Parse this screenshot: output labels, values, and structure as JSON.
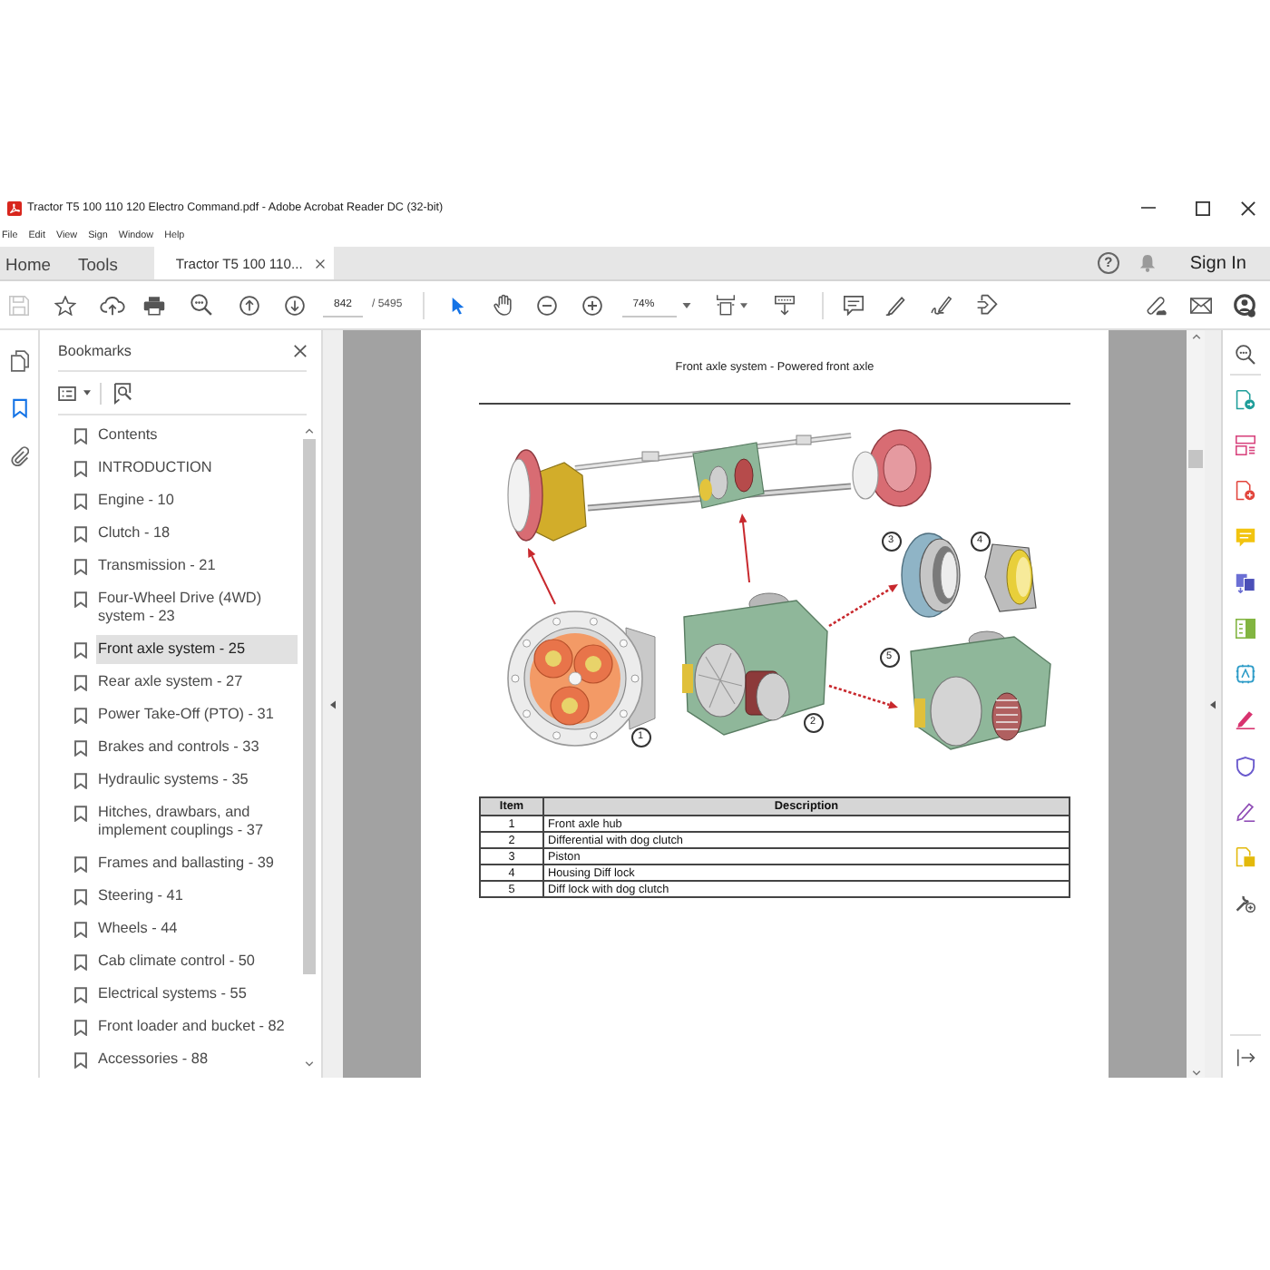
{
  "window": {
    "title": "Tractor T5 100 110 120 Electro Command.pdf - Adobe Acrobat Reader DC (32-bit)"
  },
  "menu": [
    "File",
    "Edit",
    "View",
    "Sign",
    "Window",
    "Help"
  ],
  "tabs": [
    {
      "label": "Home",
      "kind": "nav",
      "selected": false
    },
    {
      "label": "Tools",
      "kind": "nav",
      "selected": false
    },
    {
      "label": "Tractor T5 100 110...",
      "kind": "document",
      "selected": true
    }
  ],
  "account": {
    "help": "?",
    "sign_in": "Sign In"
  },
  "toolbar": {
    "save_disabled": true,
    "page_number": "842",
    "page_count": "/ 5495",
    "pointer_tools": [
      {
        "kind": "select",
        "selected": true
      },
      {
        "kind": "hand",
        "selected": false
      }
    ],
    "zoom": "74%"
  },
  "nav_rail": [
    {
      "kind": "pages",
      "selected": false
    },
    {
      "kind": "bookmarks",
      "selected": true
    },
    {
      "kind": "attachments",
      "selected": false
    }
  ],
  "bookmarks": {
    "title": "Bookmarks",
    "items": [
      {
        "label": "Contents",
        "selected": false
      },
      {
        "label": "INTRODUCTION",
        "selected": false
      },
      {
        "label": "Engine - 10",
        "selected": false
      },
      {
        "label": "Clutch - 18",
        "selected": false
      },
      {
        "label": "Transmission - 21",
        "selected": false
      },
      {
        "label": "Four-Wheel Drive (4WD) system - 23",
        "selected": false
      },
      {
        "label": "Front axle system - 25",
        "selected": true
      },
      {
        "label": "Rear axle system - 27",
        "selected": false
      },
      {
        "label": "Power Take-Off (PTO) - 31",
        "selected": false
      },
      {
        "label": "Brakes and controls - 33",
        "selected": false
      },
      {
        "label": "Hydraulic systems - 35",
        "selected": false
      },
      {
        "label": "Hitches, drawbars, and implement couplings - 37",
        "selected": false
      },
      {
        "label": "Frames and ballasting - 39",
        "selected": false
      },
      {
        "label": "Steering - 41",
        "selected": false
      },
      {
        "label": "Wheels - 44",
        "selected": false
      },
      {
        "label": "Cab climate control - 50",
        "selected": false
      },
      {
        "label": "Electrical systems - 55",
        "selected": false
      },
      {
        "label": "Front loader and bucket - 82",
        "selected": false
      },
      {
        "label": "Accessories - 88",
        "selected": false
      }
    ]
  },
  "document": {
    "heading": "Front axle system - Powered front axle",
    "figure": {
      "callouts": [
        "1",
        "2",
        "3",
        "4",
        "5"
      ]
    },
    "table": {
      "columns": [
        "Item",
        "Description"
      ],
      "rows": [
        [
          "1",
          "Front axle hub"
        ],
        [
          "2",
          "Differential with dog clutch"
        ],
        [
          "3",
          "Piston"
        ],
        [
          "4",
          "Housing Diff lock"
        ],
        [
          "5",
          "Diff lock with dog clutch"
        ]
      ]
    }
  }
}
